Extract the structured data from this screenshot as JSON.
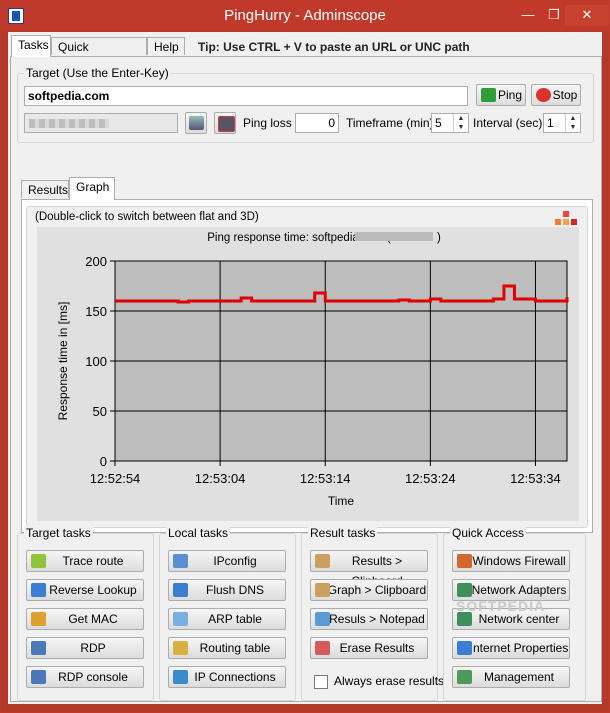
{
  "window": {
    "title": "PingHurry - Adminscope",
    "minimize": "—",
    "maximize": "❐",
    "close": "✕"
  },
  "tabs": [
    "Tasks",
    "Quick commands",
    "Help"
  ],
  "tip": "Tip: Use CTRL + V to paste an URL or UNC path",
  "target": {
    "group_label": "Target (Use the Enter-Key)",
    "host": "softpedia.com",
    "ping_button": "Ping",
    "stop_button": "Stop",
    "ping_loss_label": "Ping loss",
    "ping_loss_value": "0",
    "timeframe_label": "Timeframe (min)",
    "timeframe_value": "5",
    "interval_label": "Interval (sec)",
    "interval_value": "1"
  },
  "result_tabs": [
    "Results",
    "Graph"
  ],
  "graph": {
    "hint": "(Double-click to switch between flat and 3D)",
    "chart_title": "Ping response time: softpedia.com (",
    "chart_title_end": ")"
  },
  "chart_data": {
    "type": "line",
    "ylabel": "Response time in [ms]",
    "xlabel": "Time",
    "ylim": [
      0,
      200
    ],
    "yticks": [
      0,
      50,
      100,
      150,
      200
    ],
    "xticks": [
      "12:52:54",
      "12:53:04",
      "12:53:14",
      "12:53:24",
      "12:53:34"
    ],
    "x_seconds_range": [
      0,
      43
    ],
    "series": [
      {
        "color": "#e00000",
        "values": [
          160,
          160,
          160,
          160,
          160,
          160,
          159,
          160,
          160,
          160,
          160,
          160,
          163,
          160,
          160,
          160,
          160,
          160,
          160,
          168,
          160,
          160,
          160,
          160,
          160,
          160,
          160,
          161,
          160,
          160,
          162,
          160,
          160,
          160,
          160,
          160,
          162,
          175,
          162,
          162,
          160,
          160,
          160,
          164
        ]
      }
    ],
    "grid": true,
    "plot_background": "#bdbdbd"
  },
  "groups": {
    "target_tasks": {
      "title": "Target tasks",
      "buttons": [
        "Trace route",
        "Reverse Lookup",
        "Get MAC",
        "RDP",
        "RDP console"
      ]
    },
    "local_tasks": {
      "title": "Local tasks",
      "buttons": [
        "IPconfig",
        "Flush DNS",
        "ARP table",
        "Routing table",
        "IP Connections"
      ]
    },
    "result_tasks": {
      "title": "Result tasks",
      "buttons": [
        "Results > Clipboard",
        "Graph > Clipboard",
        "Resuls > Notepad",
        "Erase Results"
      ],
      "checkbox": "Always erase results"
    },
    "quick_access": {
      "title": "Quick Access",
      "buttons": [
        "Windows Firewall",
        "Network Adapters",
        "Network center",
        "Internet Properties",
        "Management"
      ]
    }
  },
  "watermark": "SOFTPEDIA",
  "colors": {
    "titlebar": "#c0392b",
    "ping_icon": "#2e9e3a",
    "stop_icon": "#d9342b",
    "series_line": "#e00000"
  }
}
